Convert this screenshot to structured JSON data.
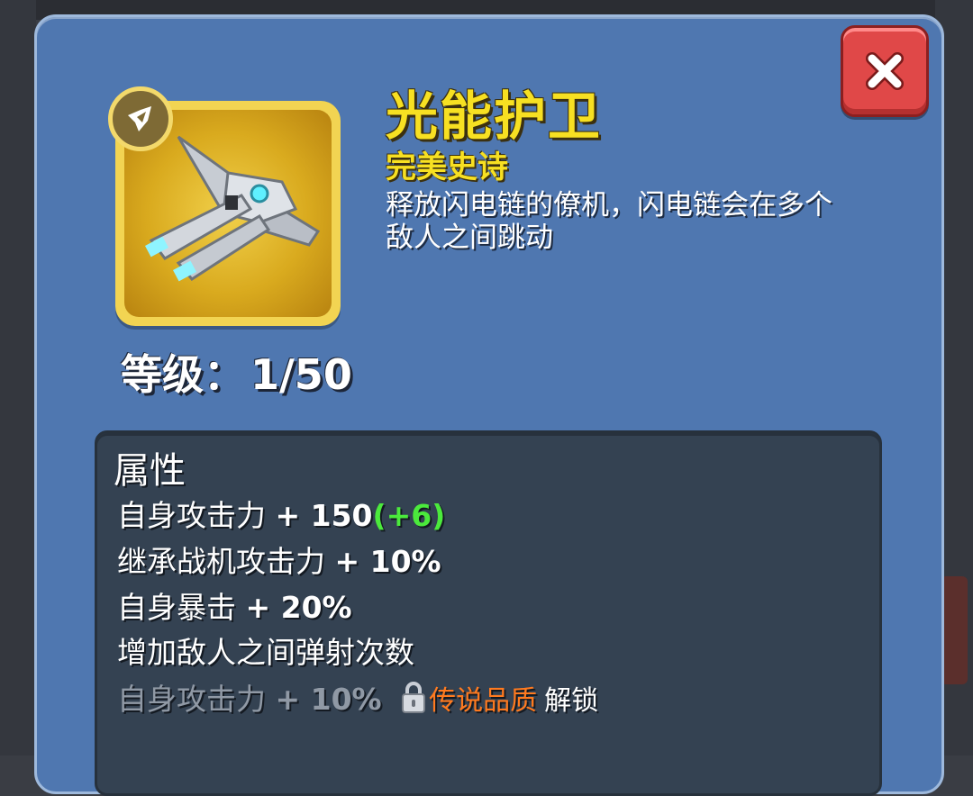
{
  "item": {
    "name": "光能护卫",
    "rarity": "完美史诗",
    "description": "释放闪电链的僚机，闪电链会在多个敌人之间跳动",
    "icon": "wingman-ship-icon",
    "type_icon": "wingman-type-icon"
  },
  "level": {
    "label": "等级：",
    "value": "1/50"
  },
  "attributes": {
    "heading": "属性",
    "rows": [
      {
        "label": "自身攻击力",
        "value": "+ 150",
        "bonus": "(+6)"
      },
      {
        "label": "继承战机攻击力",
        "value": "+ 10%"
      },
      {
        "label": "自身暴击",
        "value": "+ 20%"
      },
      {
        "label": "增加敌人之间弹射次数"
      }
    ],
    "locked_row": {
      "label": "自身攻击力",
      "value": "+ 10%",
      "quality": "传说品质",
      "unlock_text": "解锁"
    }
  },
  "colors": {
    "title": "#f7e022",
    "bonus": "#4bea3c",
    "quality": "#ff7a1f",
    "close": "#e04848"
  }
}
